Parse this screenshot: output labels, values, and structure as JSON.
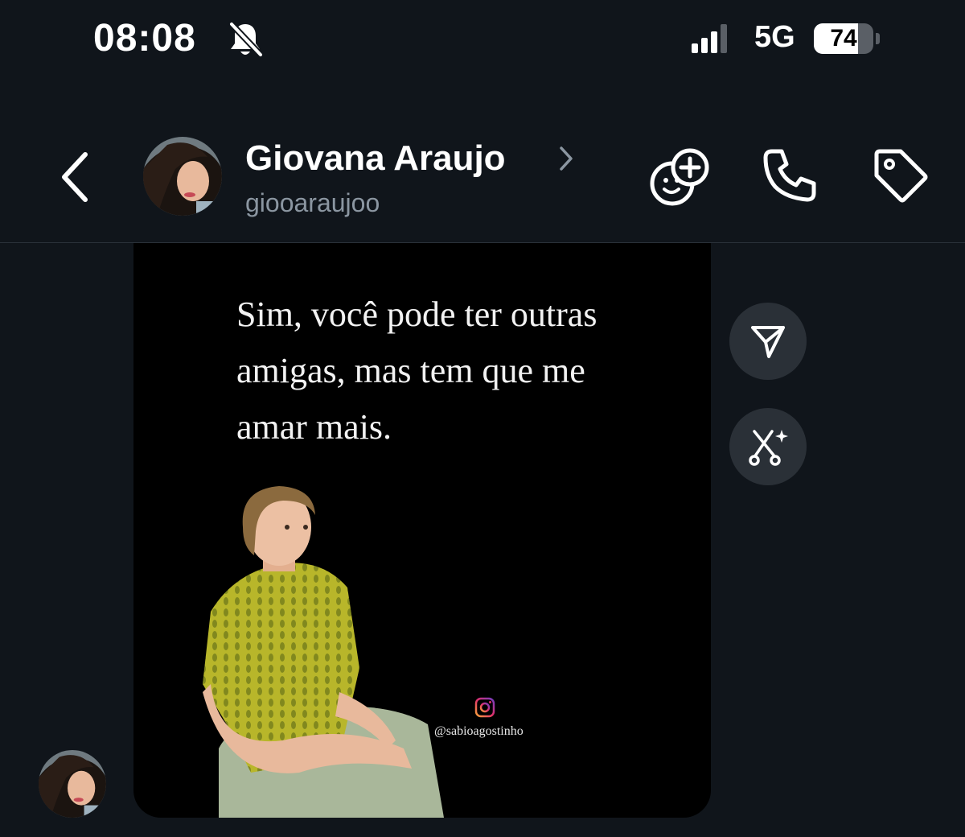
{
  "status": {
    "time": "08:08",
    "network": "5G",
    "battery": "74",
    "battery_level": 0.74
  },
  "header": {
    "name": "Giovana Araujo",
    "handle": "giooaraujoo"
  },
  "message": {
    "quote": "Sim, você pode ter outras amigas, mas tem que me amar mais.",
    "watermark": "@sabioagostinho"
  },
  "icons": {
    "back": "chevron-left-icon",
    "name_chevron": "chevron-right-icon",
    "add_group": "add-people-icon",
    "call": "phone-icon",
    "tag": "tag-icon",
    "share": "send-icon",
    "edit": "magic-scissors-icon",
    "mute": "bell-slash-icon",
    "signal": "signal-bars-icon",
    "instagram": "instagram-icon"
  },
  "colors": {
    "background": "#10151b",
    "muted_text": "#8b96a1",
    "button_bg": "#2a3037",
    "bubble_bg": "#000000"
  }
}
